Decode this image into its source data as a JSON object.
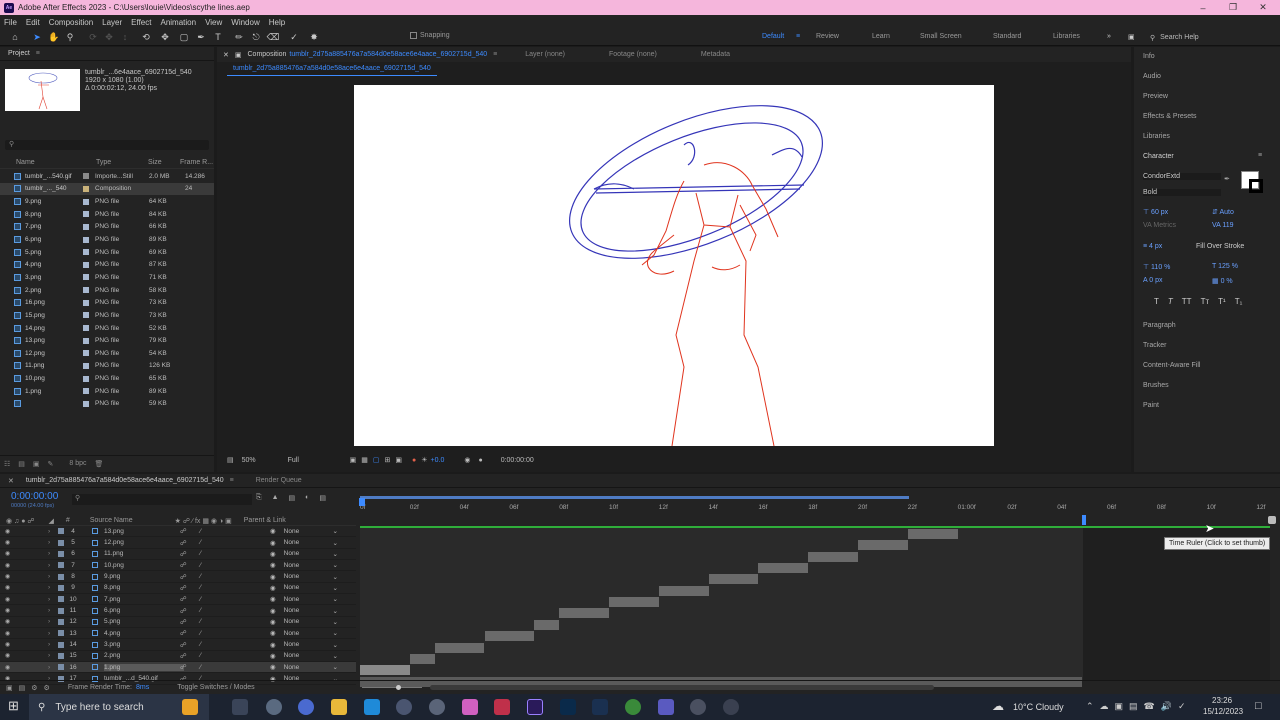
{
  "window": {
    "title": "Adobe After Effects 2023 - C:\\Users\\louie\\Videos\\scythe lines.aep",
    "app_logo": "Ae"
  },
  "menu": [
    "File",
    "Edit",
    "Composition",
    "Layer",
    "Effect",
    "Animation",
    "View",
    "Window",
    "Help"
  ],
  "toolbar": {
    "snapping_label": "Snapping",
    "search_help": "Search Help"
  },
  "workspaces": [
    {
      "label": "Default",
      "active": true
    },
    {
      "label": "Review",
      "active": false
    },
    {
      "label": "Learn",
      "active": false
    },
    {
      "label": "Small Screen",
      "active": false
    },
    {
      "label": "Standard",
      "active": false
    },
    {
      "label": "Libraries",
      "active": false
    }
  ],
  "project": {
    "title": "Project",
    "info_name": "tumblr_...6e4aace_6902715d_540",
    "info_dims": "1920 x 1080 (1.00)",
    "info_duration": "Δ 0:00:02:12, 24.00 fps",
    "columns": [
      "Name",
      "Type",
      "Size",
      "Frame R..."
    ],
    "items": [
      {
        "name": "tumblr_...540.gif",
        "type": "Importe...Still",
        "size": "2.0 MB",
        "rate": "14.286",
        "color": "#8a8a8a"
      },
      {
        "name": "tumblr_..._540",
        "type": "Composition",
        "size": "",
        "rate": "24",
        "color": "#c9b27a",
        "selected": true
      },
      {
        "name": "9.png",
        "type": "PNG file",
        "size": "64 KB",
        "rate": "",
        "color": "#a8b8d0"
      },
      {
        "name": "8.png",
        "type": "PNG file",
        "size": "84 KB",
        "rate": "",
        "color": "#a8b8d0"
      },
      {
        "name": "7.png",
        "type": "PNG file",
        "size": "66 KB",
        "rate": "",
        "color": "#a8b8d0"
      },
      {
        "name": "6.png",
        "type": "PNG file",
        "size": "89 KB",
        "rate": "",
        "color": "#a8b8d0"
      },
      {
        "name": "5.png",
        "type": "PNG file",
        "size": "69 KB",
        "rate": "",
        "color": "#a8b8d0"
      },
      {
        "name": "4.png",
        "type": "PNG file",
        "size": "87 KB",
        "rate": "",
        "color": "#a8b8d0"
      },
      {
        "name": "3.png",
        "type": "PNG file",
        "size": "71 KB",
        "rate": "",
        "color": "#a8b8d0"
      },
      {
        "name": "2.png",
        "type": "PNG file",
        "size": "58 KB",
        "rate": "",
        "color": "#a8b8d0"
      },
      {
        "name": "16.png",
        "type": "PNG file",
        "size": "73 KB",
        "rate": "",
        "color": "#a8b8d0"
      },
      {
        "name": "15.png",
        "type": "PNG file",
        "size": "73 KB",
        "rate": "",
        "color": "#a8b8d0"
      },
      {
        "name": "14.png",
        "type": "PNG file",
        "size": "52 KB",
        "rate": "",
        "color": "#a8b8d0"
      },
      {
        "name": "13.png",
        "type": "PNG file",
        "size": "79 KB",
        "rate": "",
        "color": "#a8b8d0"
      },
      {
        "name": "12.png",
        "type": "PNG file",
        "size": "54 KB",
        "rate": "",
        "color": "#a8b8d0"
      },
      {
        "name": "11.png",
        "type": "PNG file",
        "size": "126 KB",
        "rate": "",
        "color": "#a8b8d0"
      },
      {
        "name": "10.png",
        "type": "PNG file",
        "size": "65 KB",
        "rate": "",
        "color": "#a8b8d0"
      },
      {
        "name": "1.png",
        "type": "PNG file",
        "size": "89 KB",
        "rate": "",
        "color": "#a8b8d0"
      },
      {
        "name": "",
        "type": "PNG file",
        "size": "59 KB",
        "rate": "",
        "color": "#a8b8d0"
      }
    ],
    "bpc": "8 bpc"
  },
  "composition": {
    "tab_label": "Composition",
    "tab_name": "tumblr_2d75a885476a7a584d0e58ace6e4aace_6902715d_540",
    "layer_tab": "Layer (none)",
    "footage_tab": "Footage (none)",
    "metadata_tab": "Metadata",
    "sub_tab": "tumblr_2d75a885476a7a584d0e58ace6e4aace_6902715d_540",
    "zoom": "50%",
    "resolution": "Full",
    "exposure": "+0.0",
    "timecode": "0:00:00:00"
  },
  "right_panel": {
    "items": [
      "Info",
      "Audio",
      "Preview",
      "Effects & Presets",
      "Libraries"
    ],
    "character": {
      "title": "Character",
      "font": "CondorExtd",
      "style": "Bold",
      "size": "60 px",
      "leading": "Auto",
      "kerning": "Metrics",
      "tracking": "119",
      "stroke": "4 px",
      "stroke_type": "Fill Over Stroke",
      "vscale": "110 %",
      "hscale": "125 %",
      "baseline": "0 px",
      "tsume": "0 %"
    },
    "more": [
      "Paragraph",
      "Tracker",
      "Content-Aware Fill",
      "Brushes",
      "Paint"
    ]
  },
  "timeline": {
    "tab_name": "tumblr_2d75a885476a7a584d0e58ace6e4aace_6902715d_540",
    "render_queue": "Render Queue",
    "current_time": "0:00:00:00",
    "fps_label": "00000 (24.00 fps)",
    "columns": {
      "num": "#",
      "source": "Source Name",
      "parent": "Parent & Link"
    },
    "ruler": [
      "0f",
      "02f",
      "04f",
      "06f",
      "08f",
      "10f",
      "12f",
      "14f",
      "16f",
      "18f",
      "20f",
      "22f",
      "01:00f",
      "02f",
      "04f",
      "06f",
      "08f",
      "10f",
      "12f"
    ],
    "layers": [
      {
        "num": "4",
        "name": "13.png",
        "start": 22,
        "end": 24
      },
      {
        "num": "5",
        "name": "12.png",
        "start": 20,
        "end": 22
      },
      {
        "num": "6",
        "name": "11.png",
        "start": 18,
        "end": 20
      },
      {
        "num": "7",
        "name": "10.png",
        "start": 16,
        "end": 18
      },
      {
        "num": "8",
        "name": "9.png",
        "start": 14,
        "end": 16
      },
      {
        "num": "9",
        "name": "8.png",
        "start": 12,
        "end": 14
      },
      {
        "num": "10",
        "name": "7.png",
        "start": 10,
        "end": 12
      },
      {
        "num": "11",
        "name": "6.png",
        "start": 8,
        "end": 10
      },
      {
        "num": "12",
        "name": "5.png",
        "start": 7,
        "end": 8
      },
      {
        "num": "13",
        "name": "4.png",
        "start": 5,
        "end": 7
      },
      {
        "num": "14",
        "name": "3.png",
        "start": 3,
        "end": 5
      },
      {
        "num": "15",
        "name": "2.png",
        "start": 2,
        "end": 3
      },
      {
        "num": "16",
        "name": "1.png",
        "start": 0,
        "end": 2,
        "selected": true
      },
      {
        "num": "17",
        "name": "tumblr_...d_540.gif",
        "start": 0,
        "end": 29
      }
    ],
    "parent_value": "None",
    "render_time_label": "Frame Render Time:",
    "render_time": "8ms",
    "toggle_label": "Toggle Switches / Modes",
    "tooltip": "Time Ruler (Click to set thumb)"
  },
  "taskbar": {
    "search_placeholder": "Type here to search",
    "weather": "10°C  Cloudy",
    "time": "23:26",
    "date": "15/12/2023"
  }
}
